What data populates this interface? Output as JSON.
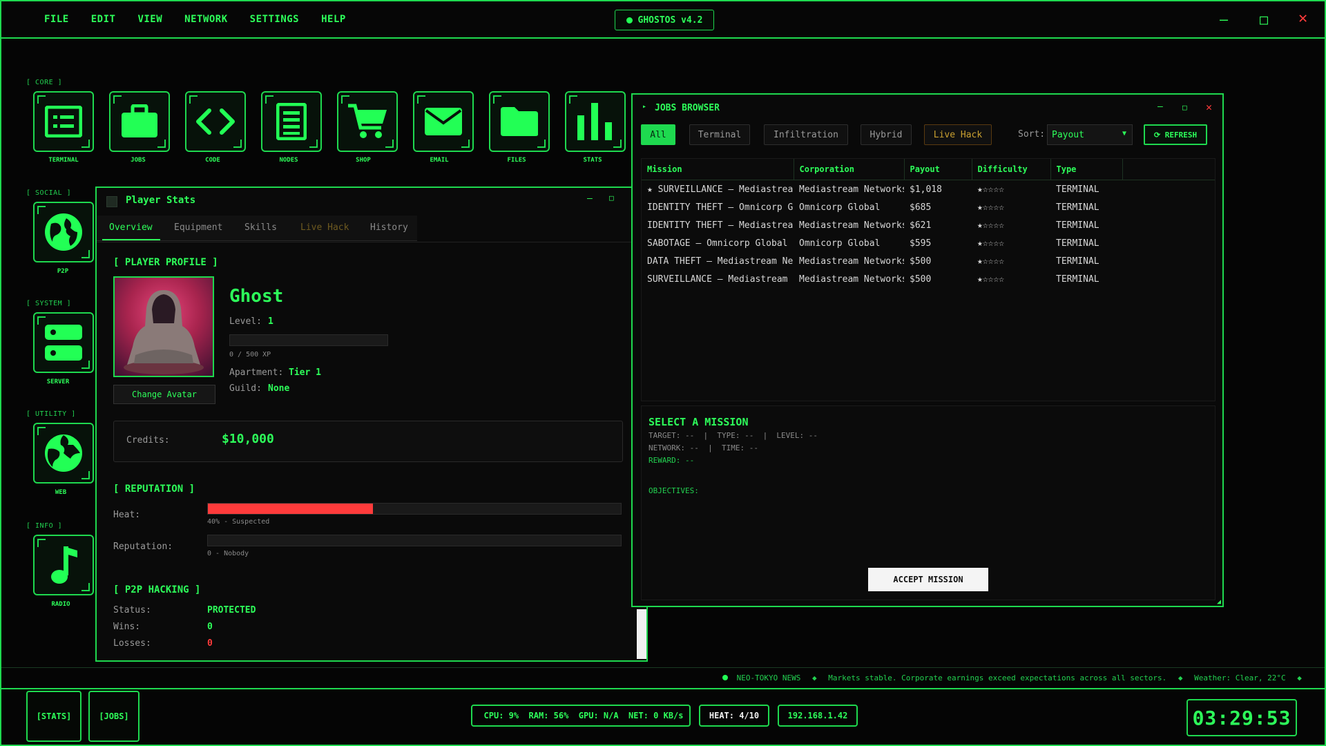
{
  "menu": [
    "FILE",
    "EDIT",
    "VIEW",
    "NETWORK",
    "SETTINGS",
    "HELP"
  ],
  "os_badge": "GHOSTOS v4.2",
  "window_controls": {
    "minimize": "—",
    "maximize": "□",
    "close": "✕"
  },
  "desktop": {
    "groups": {
      "core": "[ CORE ]",
      "social": "[ SOCIAL ]",
      "system": "[ SYSTEM ]",
      "utility": "[ UTILITY ]",
      "info": "[ INFO ]"
    },
    "core_icons": [
      {
        "label": "TERMINAL",
        "icon": "terminal-icon"
      },
      {
        "label": "JOBS",
        "icon": "briefcase-icon"
      },
      {
        "label": "CODE",
        "icon": "code-icon"
      },
      {
        "label": "NODES",
        "icon": "list-icon"
      },
      {
        "label": "SHOP",
        "icon": "cart-icon"
      },
      {
        "label": "EMAIL",
        "icon": "envelope-icon"
      },
      {
        "label": "FILES",
        "icon": "folder-icon"
      },
      {
        "label": "STATS",
        "icon": "bar-chart-icon"
      }
    ],
    "side_icons": [
      {
        "label": "P2P",
        "icon": "globe-icon"
      },
      {
        "label": "SERVER",
        "icon": "server-icon"
      },
      {
        "label": "WEB",
        "icon": "web-globe-icon"
      },
      {
        "label": "RADIO",
        "icon": "music-note-icon"
      }
    ]
  },
  "player": {
    "title": "Player Stats",
    "tabs": [
      "Overview",
      "Equipment",
      "Skills",
      "Live Hack",
      "History"
    ],
    "profile_heading": "[ PLAYER PROFILE ]",
    "name": "Ghost",
    "level_label": "Level:",
    "level": "1",
    "xp_text": "0 / 500 XP",
    "xp_fraction": 0,
    "apartment_label": "Apartment:",
    "apartment": "Tier 1",
    "guild_label": "Guild:",
    "guild": "None",
    "change_avatar": "Change Avatar",
    "credits_label": "Credits:",
    "credits": "$10,000",
    "reputation_heading": "[ REPUTATION ]",
    "heat_label": "Heat:",
    "heat_text": "40% - Suspected",
    "heat_percent": 40,
    "rep_label": "Reputation:",
    "rep_text": "0 - Nobody",
    "rep_percent": 0,
    "p2p_heading": "[ P2P HACKING ]",
    "status_label": "Status:",
    "status": "PROTECTED",
    "wins_label": "Wins:",
    "wins": "0",
    "losses_label": "Losses:",
    "losses": "0"
  },
  "jobs": {
    "title": "JOBS BROWSER",
    "filters": [
      "All",
      "Terminal",
      "Infiltration",
      "Hybrid",
      "Live Hack"
    ],
    "sort_label": "Sort:",
    "sort_value": "Payout",
    "refresh": "⟳ REFRESH",
    "columns": [
      "Mission",
      "Corporation",
      "Payout",
      "Difficulty",
      "Type"
    ],
    "rows": [
      {
        "mission": "★ SURVEILLANCE — Mediastream Network",
        "corp": "Mediastream Networks",
        "payout": "$1,018",
        "difficulty": "★☆☆☆☆",
        "type": "TERMINAL"
      },
      {
        "mission": "IDENTITY THEFT — Omnicorp Global",
        "corp": "Omnicorp Global",
        "payout": "$685",
        "difficulty": "★☆☆☆☆",
        "type": "TERMINAL"
      },
      {
        "mission": "IDENTITY THEFT — Mediastream Networks",
        "corp": "Mediastream Networks",
        "payout": "$621",
        "difficulty": "★☆☆☆☆",
        "type": "TERMINAL"
      },
      {
        "mission": "SABOTAGE — Omnicorp Global",
        "corp": "Omnicorp Global",
        "payout": "$595",
        "difficulty": "★☆☆☆☆",
        "type": "TERMINAL"
      },
      {
        "mission": "DATA THEFT — Mediastream Networks",
        "corp": "Mediastream Networks",
        "payout": "$500",
        "difficulty": "★☆☆☆☆",
        "type": "TERMINAL"
      },
      {
        "mission": "SURVEILLANCE — Mediastream",
        "corp": "Mediastream Networks",
        "payout": "$500",
        "difficulty": "★☆☆☆☆",
        "type": "TERMINAL"
      }
    ],
    "detail": {
      "heading": "SELECT A MISSION",
      "line1": "TARGET: --  |  TYPE: --  |  LEVEL: --",
      "line2": "NETWORK: --  |  TIME: --",
      "reward": "REWARD: --",
      "objectives": "OBJECTIVES:",
      "accept": "ACCEPT MISSION"
    }
  },
  "ticker": {
    "source": "NEO-TOKYO NEWS",
    "headline": "Markets stable. Corporate earnings exceed expectations across all sectors.",
    "weather": "Weather: Clear, 22°C"
  },
  "taskbar": {
    "buttons": [
      "[STATS]",
      "[JOBS]"
    ],
    "sys": "CPU: 9%  RAM: 56%  GPU: N/A  NET: 0 KB/s",
    "heat": "HEAT: 4/10",
    "ip": "192.168.1.42",
    "clock": "03:29:53"
  },
  "colors": {
    "accent": "#22ff55",
    "heat": "#ff3b3b",
    "background": "#050505"
  }
}
